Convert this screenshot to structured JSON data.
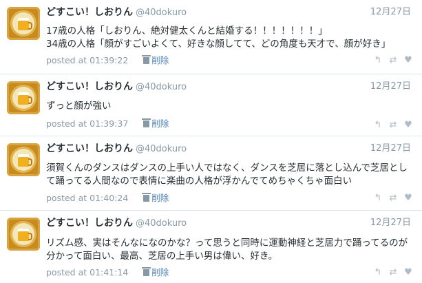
{
  "tweets": [
    {
      "name": "どすこい！しおりん",
      "handle": "@40dokuro",
      "date": "12月27日",
      "text": "17歳の人格「しおりん、絶対健太くんと結婚する！！！！！！！」\n34歳の人格「顔がすごいよくて、好きな顔してて、どの角度も天才で、顔が好き」",
      "posted": "posted at 01:39:22",
      "delete_label": "削除"
    },
    {
      "name": "どすこい！しおりん",
      "handle": "@40dokuro",
      "date": "12月27日",
      "text": "ずっと顔が強い",
      "posted": "posted at 01:39:37",
      "delete_label": "削除"
    },
    {
      "name": "どすこい！しおりん",
      "handle": "@40dokuro",
      "date": "12月27日",
      "text": "須賀くんのダンスはダンスの上手い人ではなく、ダンスを芝居に落とし込んで芝居として踊ってる人間なので表情に楽曲の人格が浮かんでてめちゃくちゃ面白い",
      "posted": "posted at 01:40:24",
      "delete_label": "削除"
    },
    {
      "name": "どすこい！しおりん",
      "handle": "@40dokuro",
      "date": "12月27日",
      "text": "リズム感、実はそんなになのかな？って思うと同時に運動神経と芝居力で踊ってるのが分かって面白い、最高、芝居の上手い男は偉い、好き。",
      "posted": "posted at 01:41:14",
      "delete_label": "削除"
    }
  ],
  "icons": {
    "reply": "reply-icon",
    "retweet": "retweet-icon",
    "like": "heart-icon",
    "delete": "trash-icon"
  }
}
